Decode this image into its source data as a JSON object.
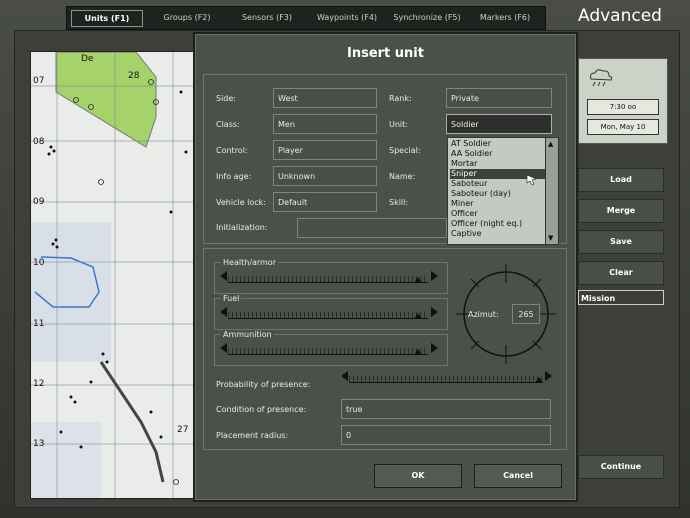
{
  "header": {
    "tabs": [
      {
        "label": "Units (F1)",
        "active": true
      },
      {
        "label": "Groups (F2)",
        "active": false
      },
      {
        "label": "Sensors (F3)",
        "active": false
      },
      {
        "label": "Waypoints (F4)",
        "active": false
      },
      {
        "label": "Synchronize (F5)",
        "active": false
      },
      {
        "label": "Markers (F6)",
        "active": false
      }
    ],
    "mode": "Advanced"
  },
  "map": {
    "grid_labels": [
      "De",
      "28",
      "07",
      "08",
      "09",
      "10",
      "11",
      "12",
      "13",
      "27"
    ]
  },
  "right_panel": {
    "time": "7:30 oo",
    "date": "Mon, May 10",
    "buttons": {
      "load": "Load",
      "merge": "Merge",
      "save": "Save",
      "clear": "Clear",
      "continue": "Continue"
    },
    "mission": "Mission"
  },
  "dialog": {
    "title": "Insert unit",
    "side_label": "Side:",
    "side_value": "West",
    "rank_label": "Rank:",
    "rank_value": "Private",
    "class_label": "Class:",
    "class_value": "Men",
    "unit_label": "Unit:",
    "unit_value": "Soldier",
    "control_label": "Control:",
    "control_value": "Player",
    "special_label": "Special:",
    "info_age_label": "Info age:",
    "info_age_value": "Unknown",
    "name_label": "Name:",
    "vehicle_lock_label": "Vehicle lock:",
    "vehicle_lock_value": "Default",
    "skill_label": "Skill:",
    "initialization_label": "Initialization:",
    "unit_options": [
      "AT Soldier",
      "AA Soldier",
      "Mortar",
      "Sniper",
      "Saboteur",
      "Saboteur (day)",
      "Miner",
      "Officer",
      "Officer (night eq.)",
      "Captive"
    ],
    "unit_selected_index": 3,
    "health_label": "Health/armor",
    "health_level": 0.95,
    "fuel_label": "Fuel",
    "fuel_level": 0.95,
    "ammo_label": "Ammunition",
    "ammo_level": 0.95,
    "azimut_label": "Azimut:",
    "azimut_value": "265",
    "probability_label": "Probability of presence:",
    "probability_level": 0.98,
    "condition_label": "Condition of presence:",
    "condition_value": "true",
    "placement_label": "Placement radius:",
    "placement_value": "0",
    "ok_label": "OK",
    "cancel_label": "Cancel"
  }
}
